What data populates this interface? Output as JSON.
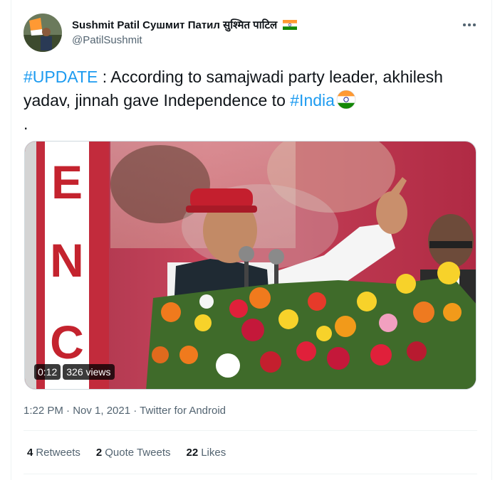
{
  "author": {
    "display_name": "Sushmit Patil Сушмит Патил सुश्मित पाटिल",
    "handle": "@PatilSushmit",
    "flag_icon": "india-flag-icon"
  },
  "tweet": {
    "segments": [
      {
        "text": "#UPDATE",
        "type": "hashtag"
      },
      {
        "text": " : According to samajwadi party leader, akhilesh yadav, jinnah gave Independence to ",
        "type": "text"
      },
      {
        "text": "#India",
        "type": "hashtag"
      }
    ],
    "trailing": "."
  },
  "media": {
    "duration": "0:12",
    "views": "326 views",
    "banner_letters": "ENC"
  },
  "meta": {
    "time": "1:22 PM",
    "date": "Nov 1, 2021",
    "source": "Twitter for Android",
    "text": "1:22 PM · Nov 1, 2021 · Twitter for Android"
  },
  "stats": {
    "retweets_count": "4",
    "retweets_label": "Retweets",
    "quotes_count": "2",
    "quotes_label": "Quote Tweets",
    "likes_count": "22",
    "likes_label": "Likes"
  },
  "colors": {
    "link": "#1d9bf0",
    "secondary_text": "#536471",
    "primary_text": "#0f1419"
  }
}
